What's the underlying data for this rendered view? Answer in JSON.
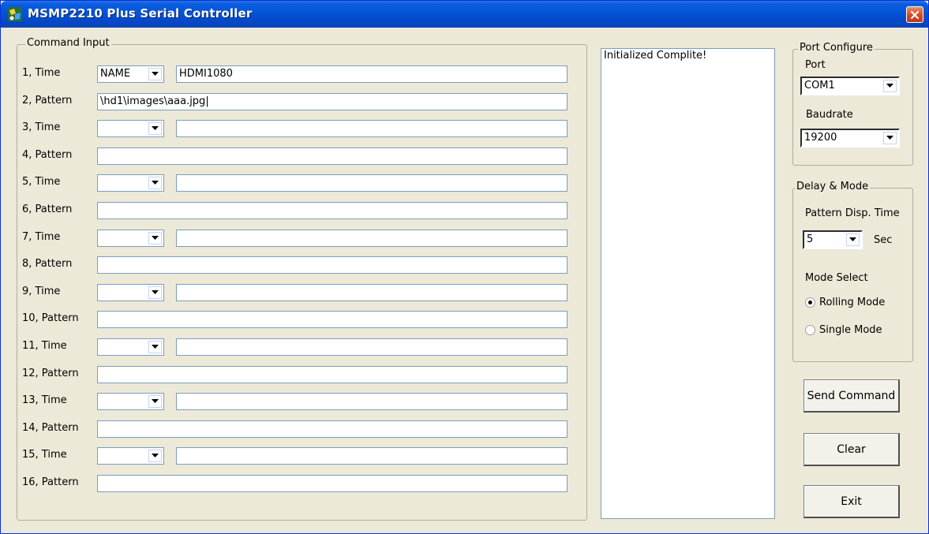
{
  "window": {
    "title": "MSMP2210 Plus Serial Controller"
  },
  "command_input": {
    "legend": "Command Input",
    "rows": [
      {
        "label": "1, Time",
        "type": "time",
        "select": "NAME",
        "value": "HDMI1080"
      },
      {
        "label": "2, Pattern",
        "type": "pattern",
        "value": "\\hd1\\images\\aaa.jpg|"
      },
      {
        "label": "3, Time",
        "type": "time",
        "select": "",
        "value": ""
      },
      {
        "label": "4, Pattern",
        "type": "pattern",
        "value": ""
      },
      {
        "label": "5, Time",
        "type": "time",
        "select": "",
        "value": ""
      },
      {
        "label": "6, Pattern",
        "type": "pattern",
        "value": ""
      },
      {
        "label": "7, Time",
        "type": "time",
        "select": "",
        "value": ""
      },
      {
        "label": "8, Pattern",
        "type": "pattern",
        "value": ""
      },
      {
        "label": "9, Time",
        "type": "time",
        "select": "",
        "value": ""
      },
      {
        "label": "10, Pattern",
        "type": "pattern",
        "value": ""
      },
      {
        "label": "11, Time",
        "type": "time",
        "select": "",
        "value": ""
      },
      {
        "label": "12, Pattern",
        "type": "pattern",
        "value": ""
      },
      {
        "label": "13, Time",
        "type": "time",
        "select": "",
        "value": ""
      },
      {
        "label": "14, Pattern",
        "type": "pattern",
        "value": ""
      },
      {
        "label": "15, Time",
        "type": "time",
        "select": "",
        "value": ""
      },
      {
        "label": "16, Pattern",
        "type": "pattern",
        "value": ""
      }
    ]
  },
  "log": {
    "text": "Initialized Complite!"
  },
  "port_configure": {
    "legend": "Port Configure",
    "port_label": "Port",
    "port_value": "COM1",
    "baudrate_label": "Baudrate",
    "baudrate_value": "19200"
  },
  "delay_mode": {
    "legend": "Delay & Mode",
    "pattern_disp_label": "Pattern Disp. Time",
    "delay_value": "5",
    "delay_unit": "Sec",
    "mode_select_label": "Mode Select",
    "rolling_label": "Rolling Mode",
    "single_label": "Single Mode",
    "selected_mode": "rolling"
  },
  "buttons": {
    "send": "Send Command",
    "clear": "Clear",
    "exit": "Exit"
  },
  "colors": {
    "titlebar": "#0553d8",
    "window_bg": "#ece9d8",
    "close": "#d14b1e"
  },
  "icons": {
    "app": "app-icon",
    "close": "close-icon",
    "dropdown": "chevron-down-icon"
  }
}
